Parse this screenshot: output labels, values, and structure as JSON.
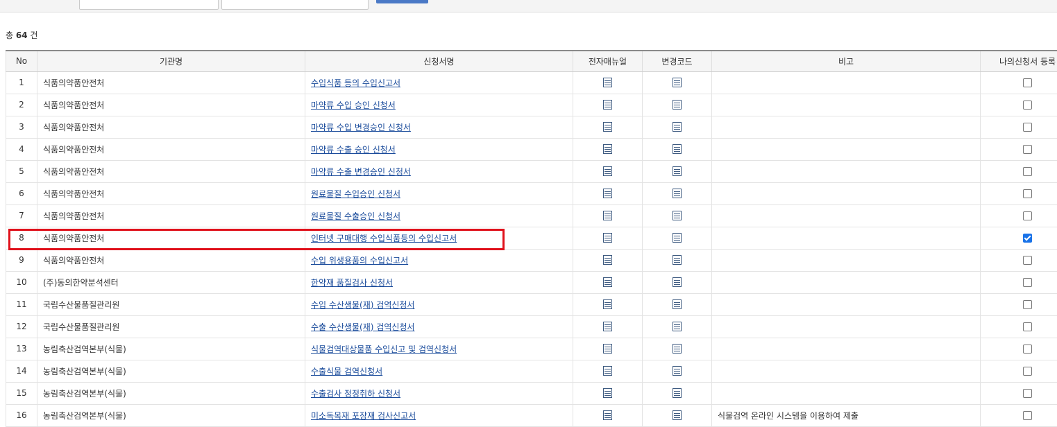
{
  "summary": {
    "prefix": "총",
    "count": "64",
    "suffix": "건"
  },
  "table": {
    "headers": [
      "No",
      "기관명",
      "신청서명",
      "전자매뉴얼",
      "변경코드",
      "비고",
      "나의신청서 등록"
    ],
    "rows": [
      {
        "no": "1",
        "org": "식품의약품안전처",
        "form": "수입식품 등의 수입신고서",
        "note": "",
        "checked": false
      },
      {
        "no": "2",
        "org": "식품의약품안전처",
        "form": "마약류 수입 승인 신청서",
        "note": "",
        "checked": false
      },
      {
        "no": "3",
        "org": "식품의약품안전처",
        "form": "마약류 수입 변경승인 신청서",
        "note": "",
        "checked": false
      },
      {
        "no": "4",
        "org": "식품의약품안전처",
        "form": "마약류 수출 승인 신청서",
        "note": "",
        "checked": false
      },
      {
        "no": "5",
        "org": "식품의약품안전처",
        "form": "마약류 수출 변경승인 신청서",
        "note": "",
        "checked": false
      },
      {
        "no": "6",
        "org": "식품의약품안전처",
        "form": "원료물질 수입승인 신청서",
        "note": "",
        "checked": false
      },
      {
        "no": "7",
        "org": "식품의약품안전처",
        "form": "원료물질 수출승인 신청서",
        "note": "",
        "checked": false
      },
      {
        "no": "8",
        "org": "식품의약품안전처",
        "form": "인터넷 구매대행 수입식품등의 수입신고서",
        "note": "",
        "checked": true
      },
      {
        "no": "9",
        "org": "식품의약품안전처",
        "form": "수입 위생용품의 수입신고서",
        "note": "",
        "checked": false
      },
      {
        "no": "10",
        "org": "(주)동의한약분석센터",
        "form": "한약재 품질검사 신청서",
        "note": "",
        "checked": false
      },
      {
        "no": "11",
        "org": "국립수산물품질관리원",
        "form": "수입 수산생물(재) 검역신청서",
        "note": "",
        "checked": false
      },
      {
        "no": "12",
        "org": "국립수산물품질관리원",
        "form": "수출 수산생물(재) 검역신청서",
        "note": "",
        "checked": false
      },
      {
        "no": "13",
        "org": "농림축산검역본부(식물)",
        "form": "식물검역대상물품 수입신고 및 검역신청서",
        "note": "",
        "checked": false
      },
      {
        "no": "14",
        "org": "농림축산검역본부(식물)",
        "form": "수출식물 검역신청서",
        "note": "",
        "checked": false
      },
      {
        "no": "15",
        "org": "농림축산검역본부(식물)",
        "form": "수출검사 정정취하 신청서",
        "note": "",
        "checked": false
      },
      {
        "no": "16",
        "org": "농림축산검역본부(식물)",
        "form": "미소독목재 포장재 검사신고서",
        "note": "식물검역 온라인 시스템을 이용하여 제출",
        "checked": false
      }
    ]
  },
  "icons": {
    "manual": "document-list-icon",
    "change_code": "document-list-icon"
  },
  "colors": {
    "link": "#1a4b9b",
    "highlight": "#e0111b",
    "checkbox_checked": "#1a73e8",
    "search_button": "#4a79c6"
  }
}
